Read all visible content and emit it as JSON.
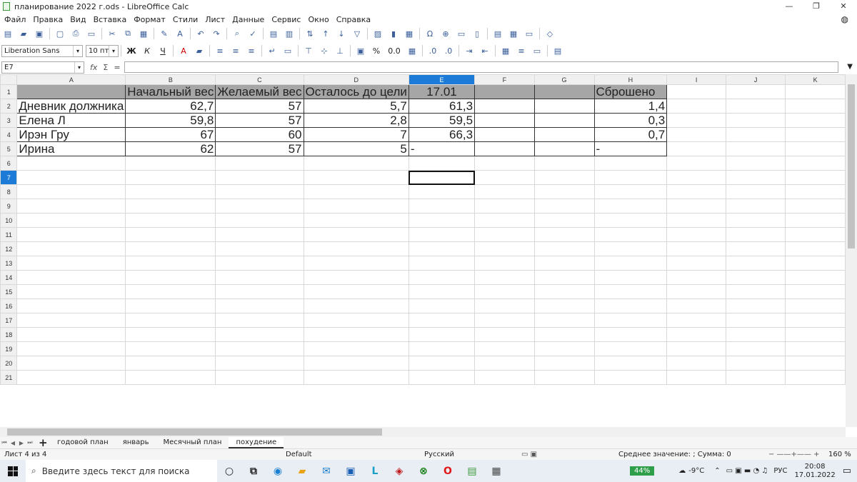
{
  "window": {
    "title": "планирование 2022 г.ods - LibreOffice Calc",
    "controls": [
      "—",
      "❐",
      "✕"
    ]
  },
  "menu": [
    "Файл",
    "Правка",
    "Вид",
    "Вставка",
    "Формат",
    "Стили",
    "Лист",
    "Данные",
    "Сервис",
    "Окно",
    "Справка"
  ],
  "toolbar2": {
    "font_name": "Liberation Sans",
    "font_size": "10 пт",
    "bold": "Ж",
    "italic": "К",
    "underline": "Ч",
    "percent": "%",
    "number": "0.0"
  },
  "formula_bar": {
    "name_box": "E7",
    "fx": "fx",
    "sum": "Σ",
    "equals": "=",
    "content": ""
  },
  "grid": {
    "columns": [
      "A",
      "B",
      "C",
      "D",
      "E",
      "F",
      "G",
      "H",
      "I",
      "J",
      "K"
    ],
    "active_column": "E",
    "active_row": "7",
    "row_numbers": [
      "1",
      "2",
      "3",
      "4",
      "5",
      "6",
      "7",
      "8",
      "9",
      "10",
      "11",
      "12",
      "13",
      "14",
      "15",
      "16",
      "17",
      "18",
      "19",
      "20",
      "21"
    ],
    "header_row": {
      "A": "",
      "B": "Начальный вес",
      "C": "Желаемый вес",
      "D": "Осталось до цели",
      "E": "17.01",
      "F": "",
      "G": "",
      "H": "Сброшено"
    },
    "rows": [
      {
        "A": "Дневник должника",
        "B": "62,7",
        "C": "57",
        "D": "5,7",
        "E": "61,3",
        "F": "",
        "G": "",
        "H": "1,4"
      },
      {
        "A": "Елена Л",
        "B": "59,8",
        "C": "57",
        "D": "2,8",
        "E": "59,5",
        "F": "",
        "G": "",
        "H": "0,3"
      },
      {
        "A": "Ирэн Гру",
        "B": "67",
        "C": "60",
        "D": "7",
        "E": "66,3",
        "F": "",
        "G": "",
        "H": "0,7"
      },
      {
        "A": "Ирина",
        "B": "62",
        "C": "57",
        "D": "5",
        "E": "-",
        "F": "",
        "G": "",
        "H": "-"
      }
    ]
  },
  "sheet_tabs": {
    "add": "+",
    "tabs": [
      "годовой план",
      "январь",
      "Месячный план",
      "похудение"
    ],
    "active": "похудение"
  },
  "status": {
    "sheet": "Лист 4 из 4",
    "style": "Default",
    "language": "Русский",
    "summary": "Среднее значение: ; Сумма: 0",
    "zoom": "160 %"
  },
  "taskbar": {
    "search_placeholder": "Введите здесь текст для поиска",
    "battery": "44%",
    "temperature": "-9°C",
    "lang": "РУС",
    "time": "20:08",
    "date": "17.01.2022"
  }
}
